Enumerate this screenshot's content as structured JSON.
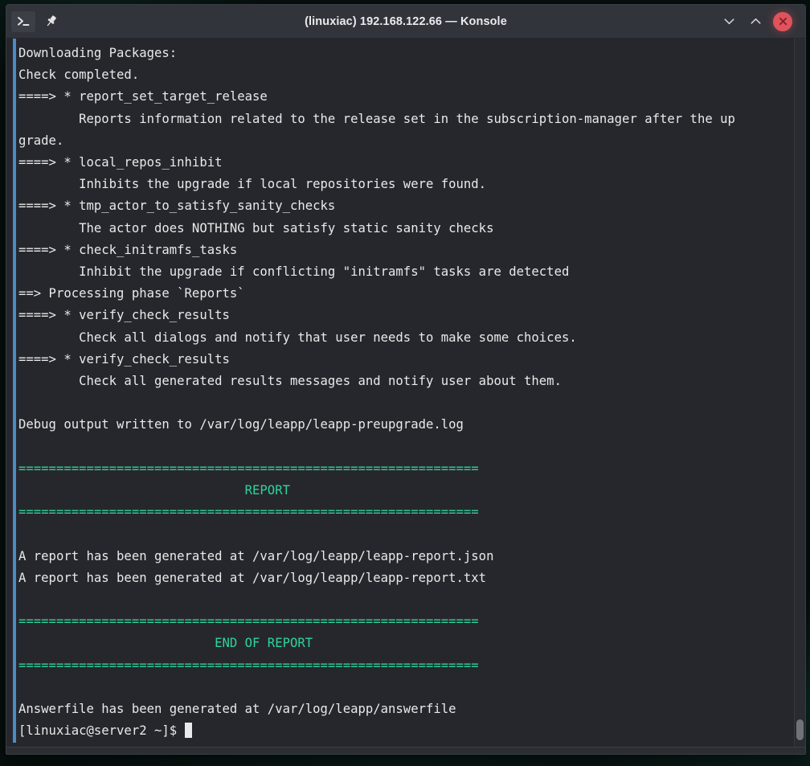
{
  "window": {
    "title": "(linuxiac) 192.168.122.66 — Konsole",
    "icons": {
      "terminal": "terminal-prompt-icon",
      "pin": "pin-icon",
      "minimize": "chevron-down-icon",
      "maximize": "chevron-up-icon",
      "close": "close-x-icon"
    },
    "colors": {
      "titlebar_bg": "#31343a",
      "terminal_bg": "#26272c",
      "text": "#e8e9ea",
      "accent_green": "#2fd39b",
      "accent_blue": "#4a8cc7",
      "close_red": "#e0535c"
    }
  },
  "terminal": {
    "separator": "=============================================================",
    "lines": [
      {
        "text": "Downloading Packages:",
        "color": "default"
      },
      {
        "text": "Check completed.",
        "color": "default"
      },
      {
        "text": "====> * report_set_target_release",
        "color": "default"
      },
      {
        "text": "        Reports information related to the release set in the subscription-manager after the up",
        "color": "default"
      },
      {
        "text": "grade.",
        "color": "default"
      },
      {
        "text": "====> * local_repos_inhibit",
        "color": "default"
      },
      {
        "text": "        Inhibits the upgrade if local repositories were found.",
        "color": "default"
      },
      {
        "text": "====> * tmp_actor_to_satisfy_sanity_checks",
        "color": "default"
      },
      {
        "text": "        The actor does NOTHING but satisfy static sanity checks",
        "color": "default"
      },
      {
        "text": "====> * check_initramfs_tasks",
        "color": "default"
      },
      {
        "text": "        Inhibit the upgrade if conflicting \"initramfs\" tasks are detected",
        "color": "default"
      },
      {
        "text": "==> Processing phase `Reports`",
        "color": "default"
      },
      {
        "text": "====> * verify_check_results",
        "color": "default"
      },
      {
        "text": "        Check all dialogs and notify that user needs to make some choices.",
        "color": "default"
      },
      {
        "text": "====> * verify_check_results",
        "color": "default"
      },
      {
        "text": "        Check all generated results messages and notify user about them.",
        "color": "default"
      },
      {
        "text": "",
        "color": "default"
      },
      {
        "text": "Debug output written to /var/log/leapp/leapp-preupgrade.log",
        "color": "default"
      },
      {
        "text": "",
        "color": "default"
      },
      {
        "text": "=============================================================",
        "color": "green"
      },
      {
        "text": "                              REPORT",
        "color": "green"
      },
      {
        "text": "=============================================================",
        "color": "green"
      },
      {
        "text": "",
        "color": "default"
      },
      {
        "text": "A report has been generated at /var/log/leapp/leapp-report.json",
        "color": "default"
      },
      {
        "text": "A report has been generated at /var/log/leapp/leapp-report.txt",
        "color": "default"
      },
      {
        "text": "",
        "color": "default"
      },
      {
        "text": "=============================================================",
        "color": "green"
      },
      {
        "text": "                          END OF REPORT",
        "color": "green"
      },
      {
        "text": "=============================================================",
        "color": "green"
      },
      {
        "text": "",
        "color": "default"
      },
      {
        "text": "Answerfile has been generated at /var/log/leapp/answerfile",
        "color": "default"
      }
    ],
    "prompt": "[linuxiac@server2 ~]$ ",
    "cursor": "block-cursor"
  }
}
